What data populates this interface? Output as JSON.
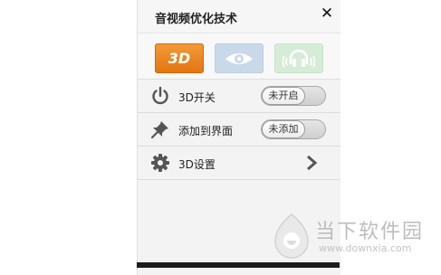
{
  "window": {
    "title": "音视频优化技术",
    "close_symbol": "✕"
  },
  "modes": [
    {
      "label": "3D",
      "icon": "3d-badge-icon",
      "color": "#e8821e",
      "selected": true
    },
    {
      "icon": "eye-icon",
      "color": "#c9d9ea"
    },
    {
      "icon": "headphones-icon",
      "color": "#d7ecd7"
    }
  ],
  "settings": [
    {
      "icon": "power-icon",
      "label": "3D开关",
      "control": "toggle",
      "value": "未开启"
    },
    {
      "icon": "pin-icon",
      "label": "添加到界面",
      "control": "toggle",
      "value": "未添加"
    },
    {
      "icon": "gear-icon",
      "label": "3D设置",
      "control": "chevron"
    }
  ],
  "watermark": {
    "text": "当下软件园",
    "url": "www.downxia.com"
  },
  "colors": {
    "accent": "#e8821e",
    "icon": "#555555"
  }
}
